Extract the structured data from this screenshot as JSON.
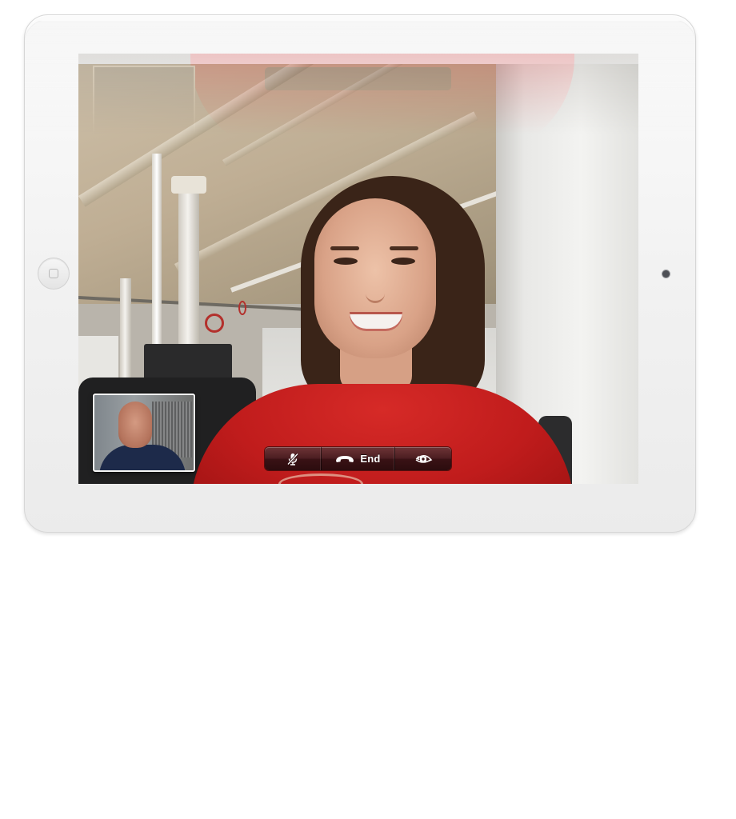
{
  "call": {
    "controls": {
      "mute_icon": "microphone-muted-icon",
      "end_icon": "phone-hangup-icon",
      "end_label": "End",
      "flip_icon": "camera-flip-icon"
    },
    "remote_video": "remote-participant-video",
    "self_view": "self-view-preview"
  },
  "colors": {
    "control_bar": "#4a1d20",
    "device_frame": "#f1f1f1",
    "shirt_red": "#c01c1c"
  }
}
